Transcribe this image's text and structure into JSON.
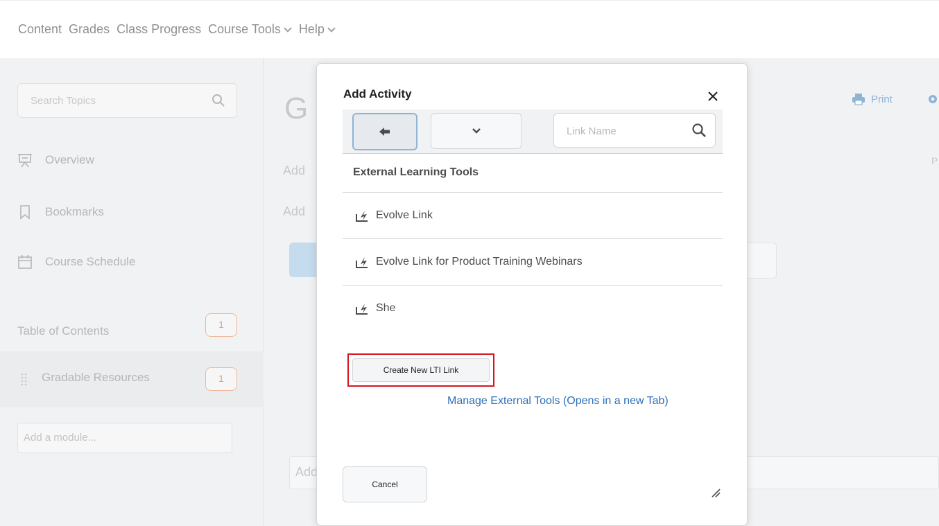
{
  "topnav": {
    "items": [
      {
        "label": "Content"
      },
      {
        "label": "Grades"
      },
      {
        "label": "Class Progress"
      },
      {
        "label": "Course Tools"
      },
      {
        "label": "Help"
      }
    ]
  },
  "sidebar": {
    "search_placeholder": "Search Topics",
    "items": [
      {
        "label": "Overview",
        "icon": "presentation-icon"
      },
      {
        "label": "Bookmarks",
        "icon": "bookmark-icon"
      },
      {
        "label": "Course Schedule",
        "icon": "calendar-icon"
      }
    ],
    "toc_label": "Table of Contents",
    "toc_count": "1",
    "module_label": "Gradable Resources",
    "module_count": "1",
    "add_module_placeholder": "Add a module..."
  },
  "main": {
    "title_initial": "G",
    "add_text_1": "Add",
    "add_text_2": "Add",
    "add_text_bottom": "Add",
    "print_label": "Print",
    "right_char": "P"
  },
  "dialog": {
    "title": "Add Activity",
    "search_placeholder": "Link Name",
    "section_heading": "External Learning Tools",
    "items": [
      {
        "label": "Evolve Link"
      },
      {
        "label": "Evolve Link for Product Training Webinars"
      },
      {
        "label": "She"
      }
    ],
    "create_button": "Create New LTI Link",
    "manage_link": "Manage External Tools (Opens in a new Tab)",
    "cancel_button": "Cancel"
  },
  "colors": {
    "accent_link": "#2c6eb5",
    "highlight_border": "#d6141e",
    "badge": "#e8a17c"
  }
}
